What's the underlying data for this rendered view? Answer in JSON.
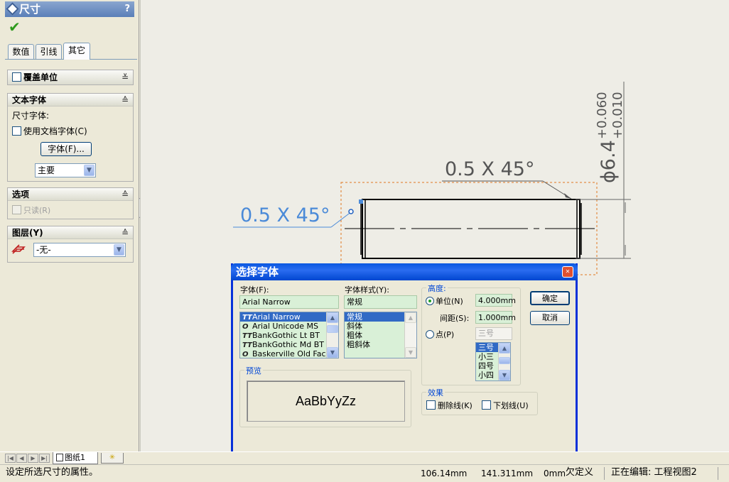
{
  "property_manager": {
    "title": "尺寸",
    "help": "?",
    "tabs": [
      "数值",
      "引线",
      "其它"
    ],
    "override_units": {
      "label": "覆盖单位"
    },
    "text_font": {
      "header": "文本字体",
      "dimension_font_label": "尺寸字体:",
      "use_doc_font": "使用文档字体(C)",
      "font_button": "字体(F)...",
      "font_select": "主要"
    },
    "options": {
      "header": "选项",
      "readonly": "只读(R)"
    },
    "layer": {
      "header": "图层(Y)",
      "value": "-无-"
    }
  },
  "drawing": {
    "chamfer_left": "0.5 X 45°",
    "chamfer_right": "0.5 X 45°",
    "diameter": "ϕ6.4",
    "tol_upper": "+0.060",
    "tol_lower": "+0.010"
  },
  "font_dialog": {
    "title": "选择字体",
    "font_label": "字体(F):",
    "font_value": "Arial Narrow",
    "fonts": [
      "Arial Narrow",
      "Arial Unicode MS",
      "BankGothic Lt BT",
      "BankGothic Md BT",
      "Baskerville Old Face"
    ],
    "font_icons": [
      "TT",
      "O",
      "TT",
      "TT",
      "O"
    ],
    "style_label": "字体样式(Y):",
    "style_value": "常规",
    "styles": [
      "常规",
      "斜体",
      "粗体",
      "粗斜体"
    ],
    "height_legend": "高度:",
    "unit_label": "单位(N)",
    "unit_value": "4.000mm",
    "spacing_label": "间距(S):",
    "spacing_value": "1.000mm",
    "points_label": "点(P)",
    "points_value": "三号",
    "points_list": [
      "三号",
      "小三",
      "四号",
      "小四"
    ],
    "ok": "确定",
    "cancel": "取消",
    "preview_legend": "预览",
    "preview_text": "AaBbYyZz",
    "effects_legend": "效果",
    "strikeout": "删除线(K)",
    "underline": "下划线(U)"
  },
  "sheet_tab": {
    "label": "图纸1"
  },
  "status_bar": {
    "message": "设定所选尺寸的属性。",
    "x": "106.14mm",
    "y": "141.311mm",
    "z": "0mm",
    "state": "欠定义",
    "editing": "正在编辑: 工程视图2"
  }
}
